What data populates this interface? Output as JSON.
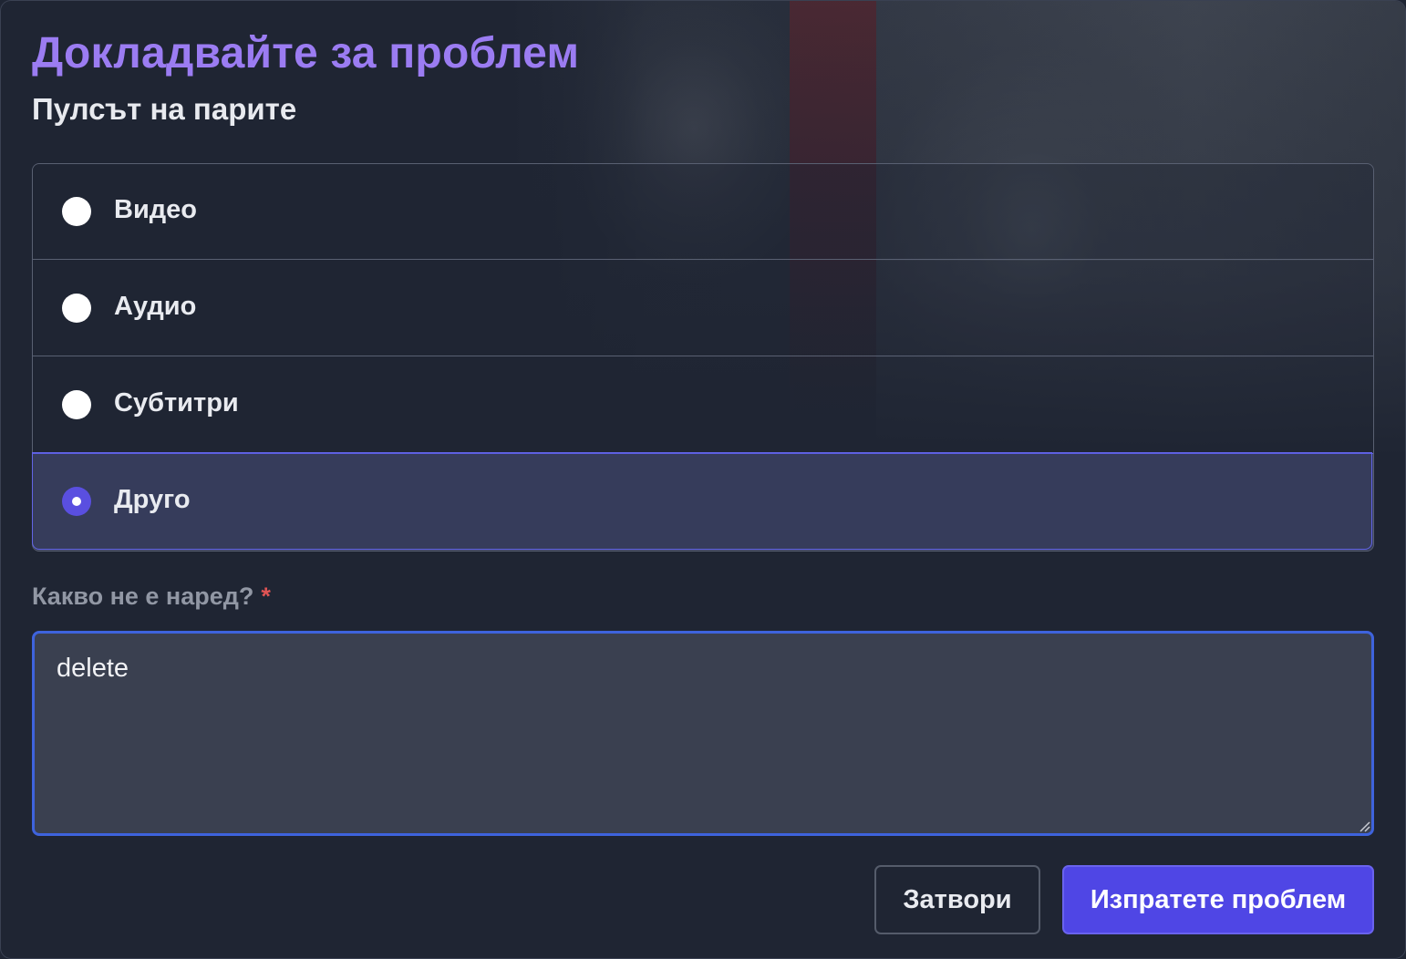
{
  "dialog": {
    "title": "Докладвайте за проблем",
    "subtitle": "Пулсът на парите"
  },
  "options": [
    {
      "label": "Видео",
      "selected": false
    },
    {
      "label": "Аудио",
      "selected": false
    },
    {
      "label": "Субтитри",
      "selected": false
    },
    {
      "label": "Друго",
      "selected": true
    }
  ],
  "description": {
    "label": "Какво не е наред?",
    "required_mark": "*",
    "value": "delete"
  },
  "buttons": {
    "close_label": "Затвори",
    "submit_label": "Изпратете проблем"
  },
  "colors": {
    "accent": "#4f46e5",
    "title": "#9b7cf2",
    "focus_ring": "#3e63dd",
    "required": "#e05454"
  }
}
